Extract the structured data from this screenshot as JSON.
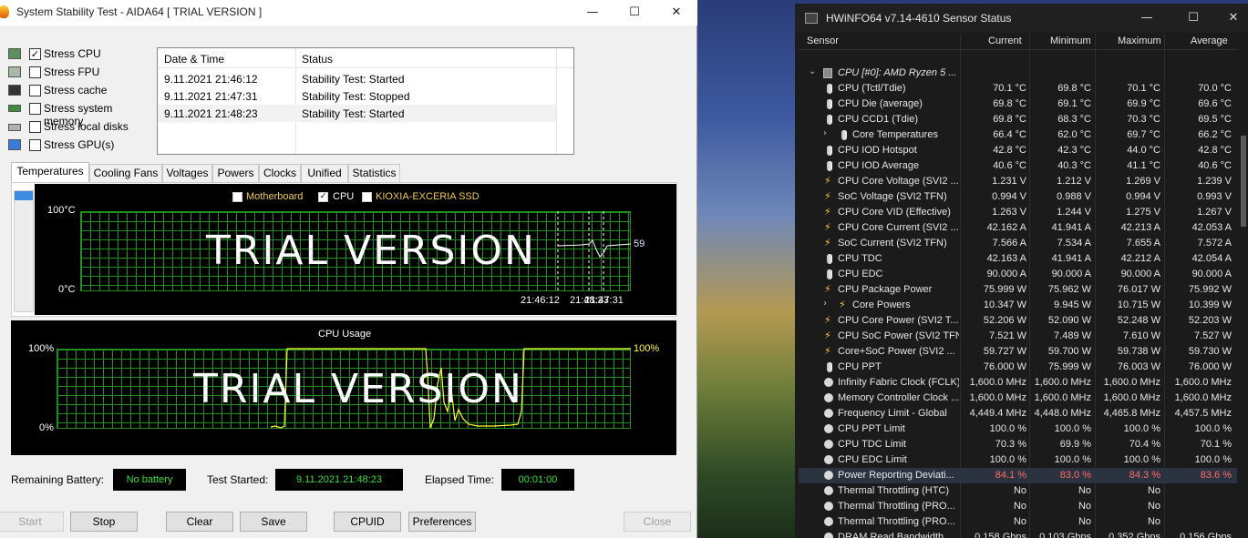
{
  "aida": {
    "title": "System Stability Test - AIDA64  [ TRIAL VERSION ]",
    "stress": [
      {
        "label": "Stress CPU",
        "checked": true
      },
      {
        "label": "Stress FPU",
        "checked": false
      },
      {
        "label": "Stress cache",
        "checked": false
      },
      {
        "label": "Stress system memory",
        "checked": false
      },
      {
        "label": "Stress local disks",
        "checked": false
      },
      {
        "label": "Stress GPU(s)",
        "checked": false
      }
    ],
    "log": {
      "col_date": "Date & Time",
      "col_status": "Status",
      "rows": [
        {
          "date": "9.11.2021 21:46:12",
          "status": "Stability Test: Started"
        },
        {
          "date": "9.11.2021 21:47:31",
          "status": "Stability Test: Stopped"
        },
        {
          "date": "9.11.2021 21:48:23",
          "status": "Stability Test: Started"
        }
      ]
    },
    "tabs": [
      "Temperatures",
      "Cooling Fans",
      "Voltages",
      "Powers",
      "Clocks",
      "Unified",
      "Statistics"
    ],
    "temp_graph": {
      "legend": [
        {
          "label": "Motherboard",
          "checked": false
        },
        {
          "label": "CPU",
          "checked": true
        },
        {
          "label": "KIOXIA-EXCERIA SSD",
          "checked": false
        }
      ],
      "ymax": "100°C",
      "ymin": "0°C",
      "current": "59",
      "time1": "21:46:12",
      "time2": "21:48:23",
      "time3": "21:47:31",
      "watermark": "TRIAL VERSION"
    },
    "usage_graph": {
      "title": "CPU Usage",
      "ymax": "100%",
      "ymin": "0%",
      "current": "100%",
      "watermark": "TRIAL VERSION"
    },
    "status": {
      "battery_label": "Remaining Battery:",
      "battery_value": "No battery",
      "started_label": "Test Started:",
      "started_value": "9.11.2021 21:48:23",
      "elapsed_label": "Elapsed Time:",
      "elapsed_value": "00:01:00"
    },
    "buttons": {
      "start": "Start",
      "stop": "Stop",
      "clear": "Clear",
      "save": "Save",
      "cpuid": "CPUID",
      "preferences": "Preferences",
      "close": "Close"
    },
    "colors": {
      "legend_text": "#f2c94c",
      "grid": "#1f8f1f",
      "trace": "#ffff00",
      "status_text": "#35e035"
    }
  },
  "hw": {
    "title": "HWiNFO64 v7.14-4610 Sensor Status",
    "columns": {
      "sensor": "Sensor",
      "current": "Current",
      "minimum": "Minimum",
      "maximum": "Maximum",
      "average": "Average"
    },
    "group": "CPU [#0]: AMD Ryzen 5 ...",
    "rows": [
      {
        "icon": "thermometer-icon",
        "name": "CPU (Tctl/Tdie)",
        "cur": "70.1 °C",
        "min": "69.8 °C",
        "max": "70.1 °C",
        "avg": "70.0 °C"
      },
      {
        "icon": "thermometer-icon",
        "name": "CPU Die (average)",
        "cur": "69.8 °C",
        "min": "69.1 °C",
        "max": "69.9 °C",
        "avg": "69.6 °C"
      },
      {
        "icon": "thermometer-icon",
        "name": "CPU CCD1 (Tdie)",
        "cur": "69.8 °C",
        "min": "68.3 °C",
        "max": "70.3 °C",
        "avg": "69.5 °C"
      },
      {
        "icon": "thermometer-icon",
        "name": "Core Temperatures",
        "cur": "66.4 °C",
        "min": "62.0 °C",
        "max": "69.7 °C",
        "avg": "66.2 °C",
        "sub": true
      },
      {
        "icon": "thermometer-icon",
        "name": "CPU IOD Hotspot",
        "cur": "42.8 °C",
        "min": "42.3 °C",
        "max": "44.0 °C",
        "avg": "42.8 °C"
      },
      {
        "icon": "thermometer-icon",
        "name": "CPU IOD Average",
        "cur": "40.6 °C",
        "min": "40.3 °C",
        "max": "41.1 °C",
        "avg": "40.6 °C"
      },
      {
        "icon": "bolt-icon",
        "name": "CPU Core Voltage (SVI2 ...",
        "cur": "1.231 V",
        "min": "1.212 V",
        "max": "1.269 V",
        "avg": "1.239 V"
      },
      {
        "icon": "bolt-icon",
        "name": "SoC Voltage (SVI2 TFN)",
        "cur": "0.994 V",
        "min": "0.988 V",
        "max": "0.994 V",
        "avg": "0.993 V"
      },
      {
        "icon": "bolt-icon",
        "name": "CPU Core VID (Effective)",
        "cur": "1.263 V",
        "min": "1.244 V",
        "max": "1.275 V",
        "avg": "1.267 V"
      },
      {
        "icon": "bolt-icon",
        "name": "CPU Core Current (SVI2 ...",
        "cur": "42.162 A",
        "min": "41.941 A",
        "max": "42.213 A",
        "avg": "42.053 A"
      },
      {
        "icon": "bolt-icon",
        "name": "SoC Current (SVI2 TFN)",
        "cur": "7.566 A",
        "min": "7.534 A",
        "max": "7.655 A",
        "avg": "7.572 A"
      },
      {
        "icon": "thermometer-icon",
        "name": "CPU TDC",
        "cur": "42.163 A",
        "min": "41.941 A",
        "max": "42.212 A",
        "avg": "42.054 A"
      },
      {
        "icon": "thermometer-icon",
        "name": "CPU EDC",
        "cur": "90.000 A",
        "min": "90.000 A",
        "max": "90.000 A",
        "avg": "90.000 A"
      },
      {
        "icon": "bolt-icon",
        "name": "CPU Package Power",
        "cur": "75.999 W",
        "min": "75.962 W",
        "max": "76.017 W",
        "avg": "75.992 W"
      },
      {
        "icon": "bolt-icon",
        "name": "Core Powers",
        "cur": "10.347 W",
        "min": "9.945 W",
        "max": "10.715 W",
        "avg": "10.399 W",
        "sub": true
      },
      {
        "icon": "bolt-icon",
        "name": "CPU Core Power (SVI2 T...",
        "cur": "52.206 W",
        "min": "52.090 W",
        "max": "52.248 W",
        "avg": "52.203 W"
      },
      {
        "icon": "bolt-icon",
        "name": "CPU SoC Power (SVI2 TFN)",
        "cur": "7.521 W",
        "min": "7.489 W",
        "max": "7.610 W",
        "avg": "7.527 W"
      },
      {
        "icon": "bolt-icon",
        "name": "Core+SoC Power (SVI2 ...",
        "cur": "59.727 W",
        "min": "59.700 W",
        "max": "59.738 W",
        "avg": "59.730 W"
      },
      {
        "icon": "thermometer-icon",
        "name": "CPU PPT",
        "cur": "76.000 W",
        "min": "75.999 W",
        "max": "76.003 W",
        "avg": "76.000 W"
      },
      {
        "icon": "clock-icon",
        "name": "Infinity Fabric Clock (FCLK)",
        "cur": "1,600.0 MHz",
        "min": "1,600.0 MHz",
        "max": "1,600.0 MHz",
        "avg": "1,600.0 MHz"
      },
      {
        "icon": "clock-icon",
        "name": "Memory Controller Clock ...",
        "cur": "1,600.0 MHz",
        "min": "1,600.0 MHz",
        "max": "1,600.0 MHz",
        "avg": "1,600.0 MHz"
      },
      {
        "icon": "clock-icon",
        "name": "Frequency Limit - Global",
        "cur": "4,449.4 MHz",
        "min": "4,448.0 MHz",
        "max": "4,465.8 MHz",
        "avg": "4,457.5 MHz"
      },
      {
        "icon": "clock-icon",
        "name": "CPU PPT Limit",
        "cur": "100.0 %",
        "min": "100.0 %",
        "max": "100.0 %",
        "avg": "100.0 %"
      },
      {
        "icon": "clock-icon",
        "name": "CPU TDC Limit",
        "cur": "70.3 %",
        "min": "69.9 %",
        "max": "70.4 %",
        "avg": "70.1 %"
      },
      {
        "icon": "clock-icon",
        "name": "CPU EDC Limit",
        "cur": "100.0 %",
        "min": "100.0 %",
        "max": "100.0 %",
        "avg": "100.0 %"
      },
      {
        "icon": "clock-icon",
        "name": "Power Reporting Deviati...",
        "cur": "84.1 %",
        "min": "83.0 %",
        "max": "84.3 %",
        "avg": "83.6 %",
        "selected": true,
        "red": true
      },
      {
        "icon": "clock-icon",
        "name": "Thermal Throttling (HTC)",
        "cur": "No",
        "min": "No",
        "max": "No",
        "avg": ""
      },
      {
        "icon": "clock-icon",
        "name": "Thermal Throttling (PRO...",
        "cur": "No",
        "min": "No",
        "max": "No",
        "avg": ""
      },
      {
        "icon": "clock-icon",
        "name": "Thermal Throttling (PRO...",
        "cur": "No",
        "min": "No",
        "max": "No",
        "avg": ""
      },
      {
        "icon": "clock-icon",
        "name": "DRAM Read Bandwidth",
        "cur": "0.158 Gbps",
        "min": "0.103 Gbps",
        "max": "0.352 Gbps",
        "avg": "0.156 Gbps"
      }
    ]
  }
}
